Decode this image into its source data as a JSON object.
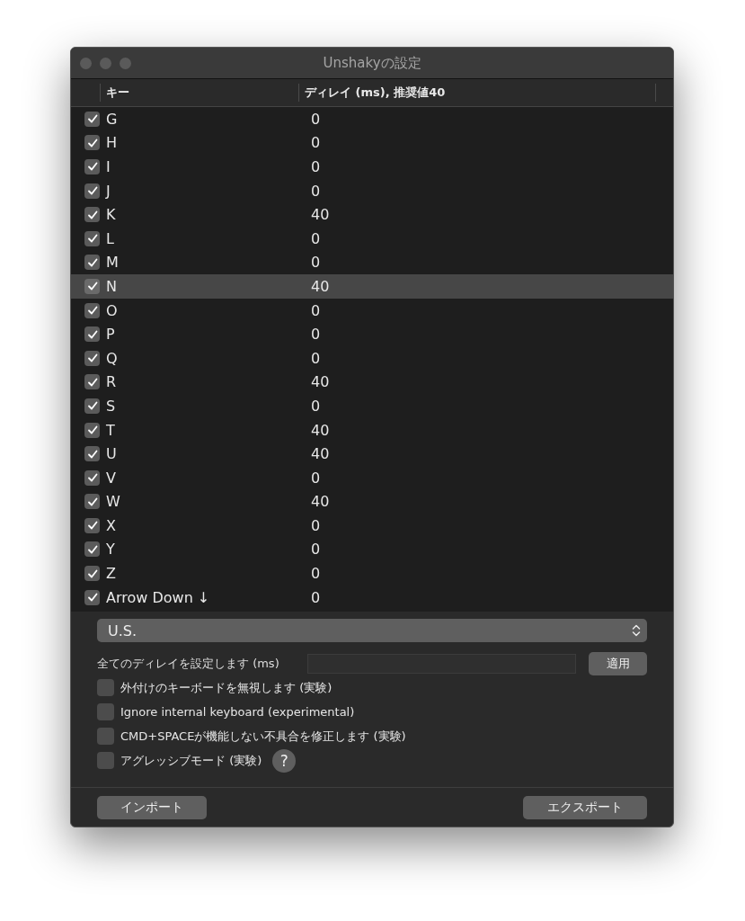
{
  "window": {
    "title": "Unshakyの設定"
  },
  "table": {
    "columns": [
      "キー",
      "ディレイ (ms), 推奨値40"
    ],
    "rows": [
      {
        "key": "G",
        "delay": "0",
        "checked": true,
        "selected": false
      },
      {
        "key": "H",
        "delay": "0",
        "checked": true,
        "selected": false
      },
      {
        "key": "I",
        "delay": "0",
        "checked": true,
        "selected": false
      },
      {
        "key": "J",
        "delay": "0",
        "checked": true,
        "selected": false
      },
      {
        "key": "K",
        "delay": "40",
        "checked": true,
        "selected": false
      },
      {
        "key": "L",
        "delay": "0",
        "checked": true,
        "selected": false
      },
      {
        "key": "M",
        "delay": "0",
        "checked": true,
        "selected": false
      },
      {
        "key": "N",
        "delay": "40",
        "checked": true,
        "selected": true
      },
      {
        "key": "O",
        "delay": "0",
        "checked": true,
        "selected": false
      },
      {
        "key": "P",
        "delay": "0",
        "checked": true,
        "selected": false
      },
      {
        "key": "Q",
        "delay": "0",
        "checked": true,
        "selected": false
      },
      {
        "key": "R",
        "delay": "40",
        "checked": true,
        "selected": false
      },
      {
        "key": "S",
        "delay": "0",
        "checked": true,
        "selected": false
      },
      {
        "key": "T",
        "delay": "40",
        "checked": true,
        "selected": false
      },
      {
        "key": "U",
        "delay": "40",
        "checked": true,
        "selected": false
      },
      {
        "key": "V",
        "delay": "0",
        "checked": true,
        "selected": false
      },
      {
        "key": "W",
        "delay": "40",
        "checked": true,
        "selected": false
      },
      {
        "key": "X",
        "delay": "0",
        "checked": true,
        "selected": false
      },
      {
        "key": "Y",
        "delay": "0",
        "checked": true,
        "selected": false
      },
      {
        "key": "Z",
        "delay": "0",
        "checked": true,
        "selected": false
      },
      {
        "key": "Arrow Down ↓",
        "delay": "0",
        "checked": true,
        "selected": false
      }
    ]
  },
  "layout_select": {
    "value": "U.S."
  },
  "set_all": {
    "label": "全てのディレイを設定します (ms)",
    "button": "適用"
  },
  "options": [
    {
      "label": "外付けのキーボードを無視します (実験)",
      "checked": false
    },
    {
      "label": "Ignore internal keyboard (experimental)",
      "checked": false
    },
    {
      "label": "CMD+SPACEが機能しない不具合を修正します (実験)",
      "checked": false
    },
    {
      "label": "アグレッシブモード (実験)",
      "checked": false,
      "help": "?"
    }
  ],
  "buttons": {
    "import": "インポート",
    "export": "エクスポート"
  }
}
